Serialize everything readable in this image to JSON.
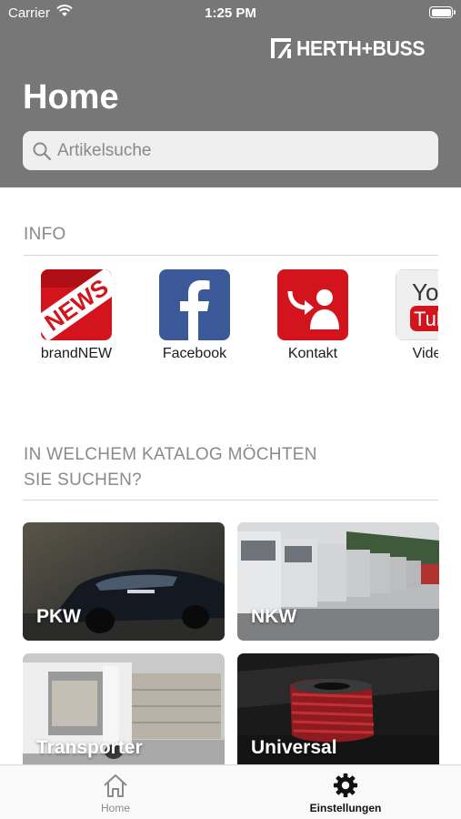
{
  "status_bar": {
    "carrier": "Carrier",
    "time": "1:25 PM"
  },
  "header": {
    "logo_text": "HERTH+BUSS",
    "title": "Home",
    "search": {
      "placeholder": "Artikelsuche",
      "value": ""
    }
  },
  "info_section": {
    "title": "INFO",
    "items": [
      {
        "label": "brandNEW",
        "icon": "news-icon"
      },
      {
        "label": "Facebook",
        "icon": "facebook-icon"
      },
      {
        "label": "Kontakt",
        "icon": "contact-icon"
      },
      {
        "label": "Video",
        "icon": "youtube-icon"
      }
    ]
  },
  "catalog_section": {
    "title_line1": "IN WELCHEM KATALOG MÖCHTEN",
    "title_line2": "SIE SUCHEN?",
    "tiles": [
      {
        "label": "PKW"
      },
      {
        "label": "NKW"
      },
      {
        "label": "Transporter"
      },
      {
        "label": "Universal"
      }
    ]
  },
  "tab_bar": {
    "tabs": [
      {
        "label": "Home",
        "icon": "house-icon",
        "active": false
      },
      {
        "label": "Einstellungen",
        "icon": "gear-icon",
        "active": true
      }
    ]
  },
  "colors": {
    "header_bg": "#777777",
    "accent_red": "#d4141c",
    "facebook_blue": "#3b5998",
    "section_text": "#8a8a8a"
  }
}
